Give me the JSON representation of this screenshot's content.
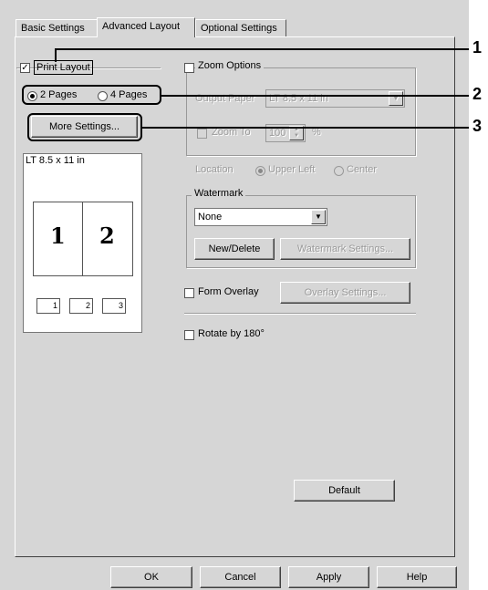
{
  "tabs": [
    "Basic Settings",
    "Advanced Layout",
    "Optional Settings"
  ],
  "print_layout": {
    "label": "Print Layout",
    "checked": true
  },
  "pages": {
    "option1": "2 Pages",
    "option2": "4 Pages",
    "selected": "2 Pages"
  },
  "more_settings": "More Settings...",
  "preview": {
    "paper": "LT 8.5 x 11 in",
    "page1": "1",
    "page2": "2",
    "mini1": "1",
    "mini2": "2",
    "mini3": "3"
  },
  "zoom": {
    "label": "Zoom Options",
    "output_paper_label": "Output Paper",
    "output_paper_value": "LT 8.5 x 11 in",
    "zoom_to_label": "Zoom To",
    "zoom_to_value": "100",
    "percent": "%",
    "location_label": "Location",
    "upper_left": "Upper Left",
    "center": "Center"
  },
  "watermark": {
    "label": "Watermark",
    "value": "None",
    "new_delete": "New/Delete",
    "settings": "Watermark Settings..."
  },
  "form_overlay": {
    "label": "Form Overlay",
    "settings": "Overlay Settings..."
  },
  "rotate": {
    "label": "Rotate by 180°"
  },
  "default_button": "Default",
  "footer": {
    "ok": "OK",
    "cancel": "Cancel",
    "apply": "Apply",
    "help": "Help"
  },
  "callouts": [
    "1",
    "2",
    "3"
  ]
}
